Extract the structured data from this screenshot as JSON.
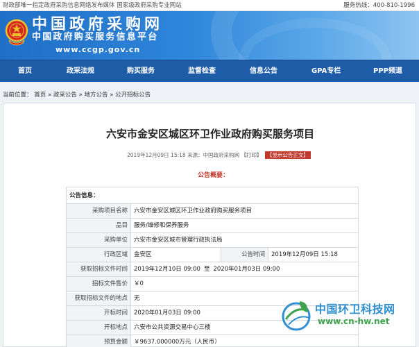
{
  "topbar": {
    "slogan": "财政部唯一指定政府采购信息网络发布媒体 国家级政府采购专业网站",
    "hotline": "服务热线：400-810-1996"
  },
  "header": {
    "site_name": "中国政府采购网",
    "site_subtitle": "中国政府购买服务信息平台",
    "site_url": "www.ccgp.gov.cn"
  },
  "nav": {
    "items": [
      "首页",
      "政采法规",
      "购买服务",
      "监督检查",
      "信息公告",
      "GPA专栏",
      "PPP频道"
    ]
  },
  "breadcrumb": {
    "prefix": "当前位置：",
    "items": [
      "首页",
      "政采公告",
      "地方公告",
      "公开招标公告"
    ],
    "sep": "»"
  },
  "article": {
    "title": "六安市金安区城区环卫作业政府购买服务项目",
    "date": "2019年12月09日 15:18",
    "source_label": "来源：",
    "source": "中国政府采购网",
    "print_label": "【打印】",
    "show_label": "【显示公告正文】",
    "summary_heading": "公告概要："
  },
  "info": {
    "section_title": "公告信息：",
    "rows": {
      "project_name": {
        "label": "采购项目名称",
        "value": "六安市金安区城区环卫作业政府购买服务项目"
      },
      "category": {
        "label": "品目",
        "value": "服务/维修和保养服务"
      },
      "purchaser": {
        "label": "采购单位",
        "value": "六安市金安区城市管理行政执法局"
      },
      "region": {
        "label": "行政区域",
        "value": "金安区"
      },
      "publish_time": {
        "label": "公告时间",
        "value": "2019年12月09日 15:18"
      },
      "doc_time": {
        "label": "获取招标文件时间",
        "value_start": "2019年12月10日 09:00",
        "sep": "至",
        "value_end": "2020年01月03日 09:00"
      },
      "doc_price": {
        "label": "招标文件售价",
        "value": "￥0"
      },
      "doc_place": {
        "label": "获取招标文件的地点",
        "value": "无"
      },
      "open_time": {
        "label": "开标时间",
        "value": "2020年01月03日 09:00"
      },
      "open_place": {
        "label": "开标地点",
        "value": "六安市公共资源交易中心三楼"
      },
      "budget": {
        "label": "预算金额",
        "value": "￥9637.000000万元（人民币）"
      }
    }
  },
  "watermark": {
    "name": "中国环卫科技网",
    "url": "www.cn-hw.net"
  },
  "colors": {
    "nav_bg": "#1e5ca8",
    "banner": "#2f86da",
    "accent_red": "#c0392b"
  }
}
